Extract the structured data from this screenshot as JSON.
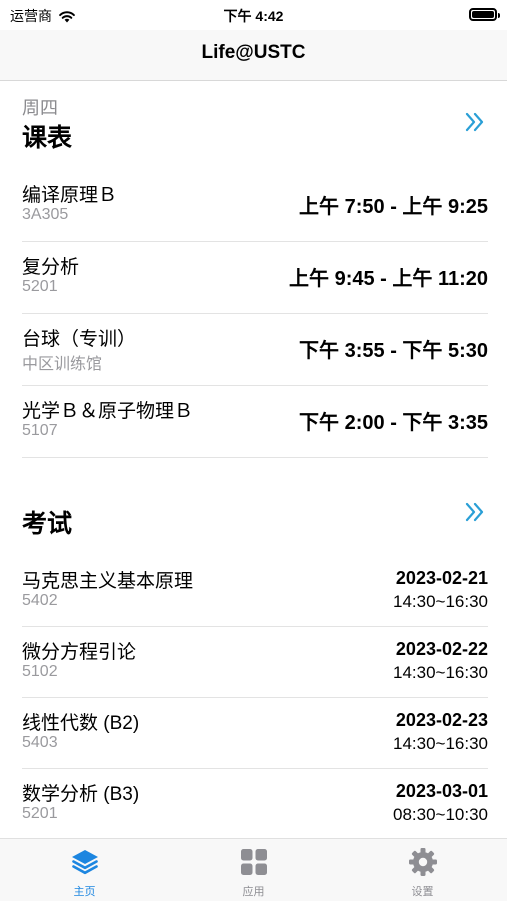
{
  "status_bar": {
    "carrier": "运营商",
    "time": "下午 4:42"
  },
  "nav": {
    "title": "Life@USTC"
  },
  "schedule": {
    "weekday": "周四",
    "title": "课表",
    "courses": [
      {
        "name": "编译原理Ｂ",
        "room": "3A305",
        "time": "上午 7:50 - 上午 9:25"
      },
      {
        "name": "复分析",
        "room": "5201",
        "time": "上午 9:45 - 上午 11:20"
      },
      {
        "name": "台球（专训）",
        "room": "中区训练馆",
        "time": "下午 3:55 - 下午 5:30"
      },
      {
        "name": "光学Ｂ＆原子物理Ｂ",
        "room": "5107",
        "time": "下午 2:00 - 下午 3:35"
      }
    ]
  },
  "exams": {
    "title": "考试",
    "items": [
      {
        "name": "马克思主义基本原理",
        "room": "5402",
        "date": "2023-02-21",
        "time": "14:30~16:30"
      },
      {
        "name": "微分方程引论",
        "room": "5102",
        "date": "2023-02-22",
        "time": "14:30~16:30"
      },
      {
        "name": "线性代数 (B2)",
        "room": "5403",
        "date": "2023-02-23",
        "time": "14:30~16:30"
      },
      {
        "name": "数学分析 (B3)",
        "room": "5201",
        "date": "2023-03-01",
        "time": "08:30~10:30"
      }
    ]
  },
  "tabs": [
    {
      "label": "主页",
      "icon": "stack-icon",
      "active": true
    },
    {
      "label": "应用",
      "icon": "grid-icon",
      "active": false
    },
    {
      "label": "设置",
      "icon": "gear-icon",
      "active": false
    }
  ],
  "colors": {
    "accent": "#1d86e0",
    "chevron": "#2a9fd6",
    "secondary_text": "#9a9a9e"
  }
}
